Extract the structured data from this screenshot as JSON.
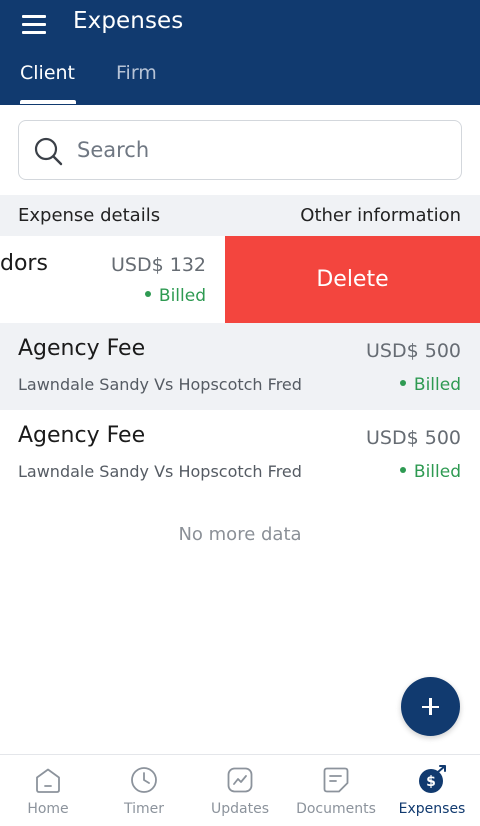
{
  "header": {
    "title": "Expenses",
    "tabs": [
      {
        "label": "Client",
        "active": true
      },
      {
        "label": "Firm",
        "active": false
      }
    ]
  },
  "search": {
    "placeholder": "Search",
    "value": ""
  },
  "columns": {
    "left": "Expense details",
    "right": "Other information"
  },
  "swiped_row": {
    "name_fragment": "dors",
    "amount": "USD$ 132",
    "status": "Billed",
    "action_label": "Delete"
  },
  "rows": [
    {
      "name": "Agency Fee",
      "matter": "Lawndale Sandy Vs Hopscotch Fred",
      "amount": "USD$ 500",
      "status": "Billed"
    },
    {
      "name": "Agency Fee",
      "matter": "Lawndale Sandy Vs Hopscotch Fred",
      "amount": "USD$ 500",
      "status": "Billed"
    }
  ],
  "empty_text": "No more data",
  "bottom_nav": [
    {
      "label": "Home",
      "icon": "home-icon",
      "active": false
    },
    {
      "label": "Timer",
      "icon": "clock-icon",
      "active": false
    },
    {
      "label": "Updates",
      "icon": "trend-chart-icon",
      "active": false
    },
    {
      "label": "Documents",
      "icon": "document-icon",
      "active": false
    },
    {
      "label": "Expenses",
      "icon": "expense-dollar-icon",
      "active": true
    }
  ],
  "colors": {
    "primary": "#113a6f",
    "delete": "#f3453e",
    "billed": "#2e9a52",
    "header_band": "#f0f2f5",
    "row_alt": "#f0f2f5"
  }
}
